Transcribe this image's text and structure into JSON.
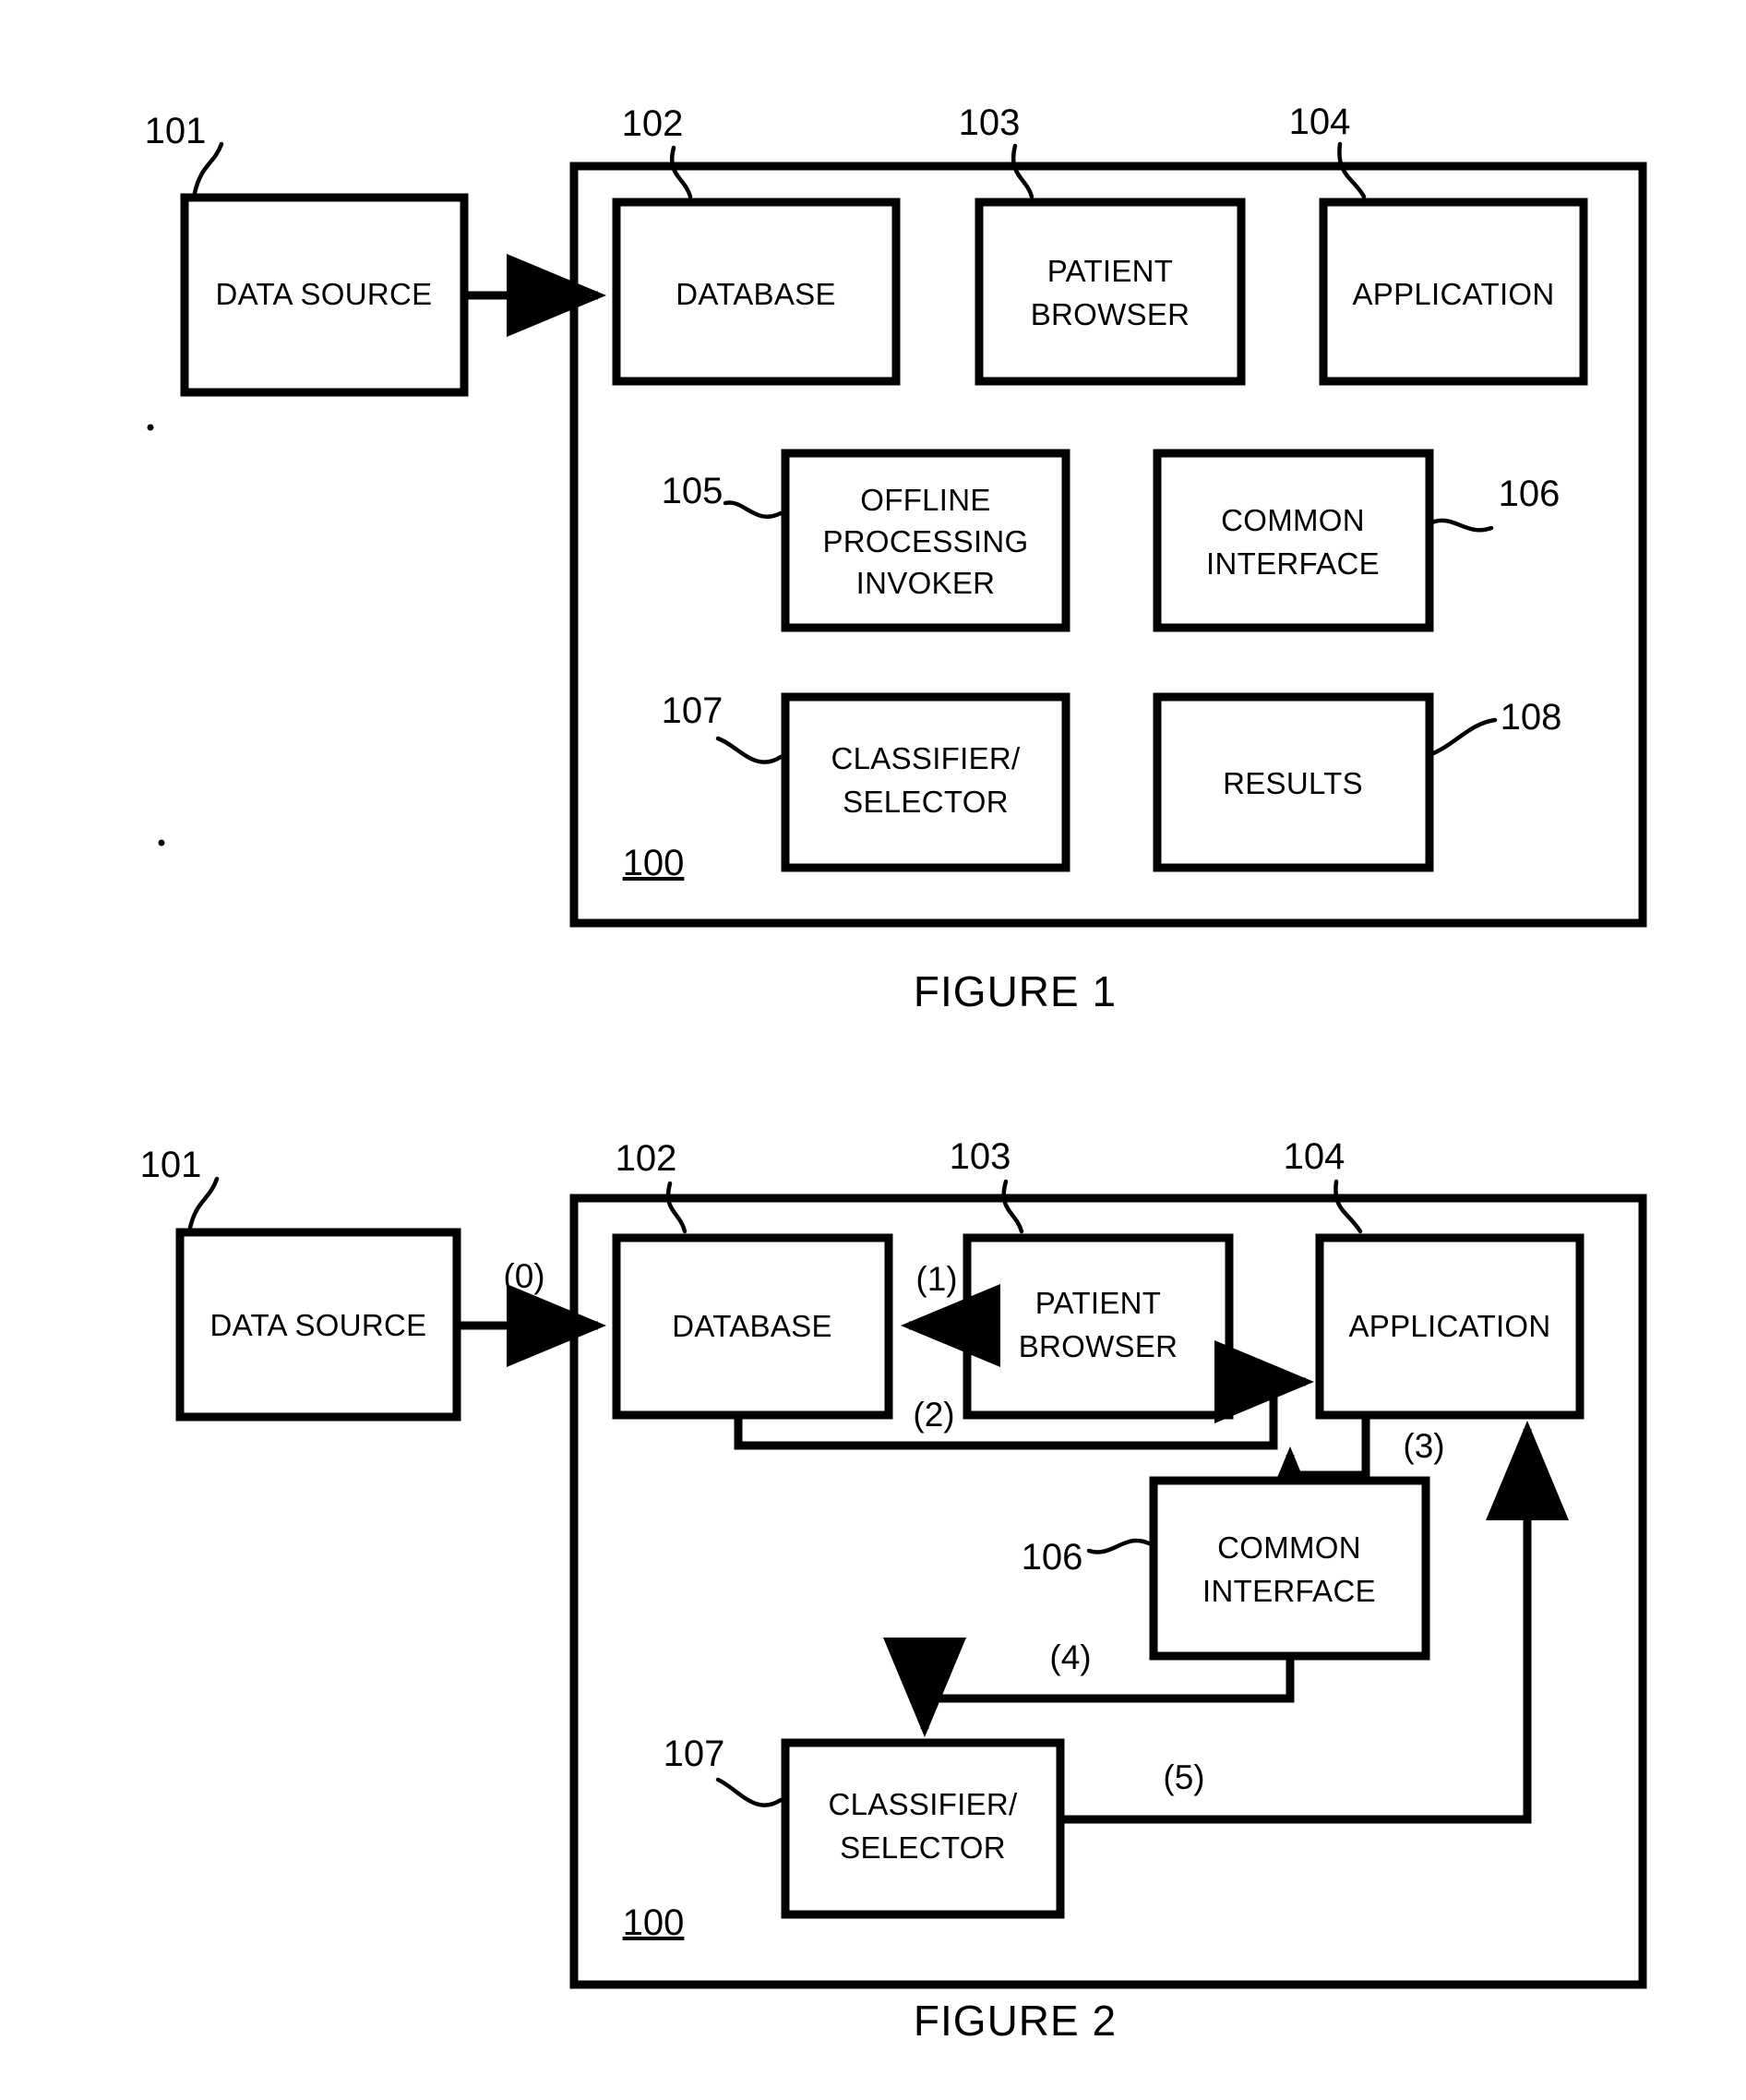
{
  "document": {
    "type": "patent-drawing-sheet",
    "background_color": "#ffffff",
    "line_color": "#000000"
  },
  "figure1": {
    "caption": "FIGURE 1",
    "system_ref": "100",
    "external_block": {
      "label": "DATA SOURCE",
      "ref": "101"
    },
    "blocks": [
      {
        "label": "DATABASE",
        "ref": "102"
      },
      {
        "label": "PATIENT\nBROWSER",
        "ref": "103",
        "line1": "PATIENT",
        "line2": "BROWSER"
      },
      {
        "label": "APPLICATION",
        "ref": "104"
      },
      {
        "label": "OFFLINE PROCESSING INVOKER",
        "ref": "105",
        "line1": "OFFLINE",
        "line2": "PROCESSING",
        "line3": "INVOKER"
      },
      {
        "label": "COMMON INTERFACE",
        "ref": "106",
        "line1": "COMMON",
        "line2": "INTERFACE"
      },
      {
        "label": "CLASSIFIER/ SELECTOR",
        "ref": "107",
        "line1": "CLASSIFIER/",
        "line2": "SELECTOR"
      },
      {
        "label": "RESULTS",
        "ref": "108"
      }
    ],
    "connections": [
      {
        "from": "DATA SOURCE",
        "to": "DATABASE",
        "label": "",
        "arrow": "right"
      }
    ]
  },
  "figure2": {
    "caption": "FIGURE 2",
    "system_ref": "100",
    "external_block": {
      "label": "DATA SOURCE",
      "ref": "101"
    },
    "blocks": [
      {
        "label": "DATABASE",
        "ref": "102"
      },
      {
        "label": "PATIENT BROWSER",
        "ref": "103",
        "line1": "PATIENT",
        "line2": "BROWSER"
      },
      {
        "label": "APPLICATION",
        "ref": "104"
      },
      {
        "label": "COMMON INTERFACE",
        "ref": "106",
        "line1": "COMMON",
        "line2": "INTERFACE"
      },
      {
        "label": "CLASSIFIER/ SELECTOR",
        "ref": "107",
        "line1": "CLASSIFIER/",
        "line2": "SELECTOR"
      }
    ],
    "flow_steps": [
      {
        "id": "0",
        "label": "(0)",
        "from": "DATA SOURCE",
        "to": "DATABASE"
      },
      {
        "id": "1",
        "label": "(1)",
        "from": "PATIENT BROWSER",
        "to": "DATABASE"
      },
      {
        "id": "2",
        "label": "(2)",
        "from": "DATABASE",
        "to": "APPLICATION"
      },
      {
        "id": "3",
        "label": "(3)",
        "from": "APPLICATION",
        "to": "COMMON INTERFACE"
      },
      {
        "id": "4",
        "label": "(4)",
        "from": "COMMON INTERFACE",
        "to": "CLASSIFIER/ SELECTOR"
      },
      {
        "id": "5",
        "label": "(5)",
        "from": "CLASSIFIER/ SELECTOR",
        "to": "APPLICATION"
      }
    ]
  }
}
